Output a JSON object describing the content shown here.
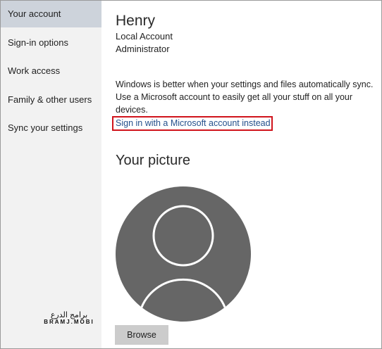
{
  "sidebar": {
    "items": [
      {
        "label": "Your account"
      },
      {
        "label": "Sign-in options"
      },
      {
        "label": "Work access"
      },
      {
        "label": "Family & other users"
      },
      {
        "label": "Sync your settings"
      }
    ],
    "selected_index": 0
  },
  "account": {
    "name": "Henry",
    "type": "Local Account",
    "role": "Administrator",
    "sync_message": "Windows is better when your settings and files automatically sync. Use a Microsoft account to easily get all your stuff on all your devices.",
    "signin_link": "Sign in with a Microsoft account instead"
  },
  "picture": {
    "heading": "Your picture",
    "browse_label": "Browse"
  },
  "watermark": {
    "arabic": "برامج الدرع",
    "latin": "BRAMJ.MOBI"
  },
  "colors": {
    "sidebar_bg": "#f2f2f2",
    "selected_bg": "#cdd3db",
    "link": "#24508c",
    "highlight_border": "#d0141c",
    "avatar_fill": "#666666"
  },
  "icons": {
    "avatar": "user-silhouette-icon"
  }
}
